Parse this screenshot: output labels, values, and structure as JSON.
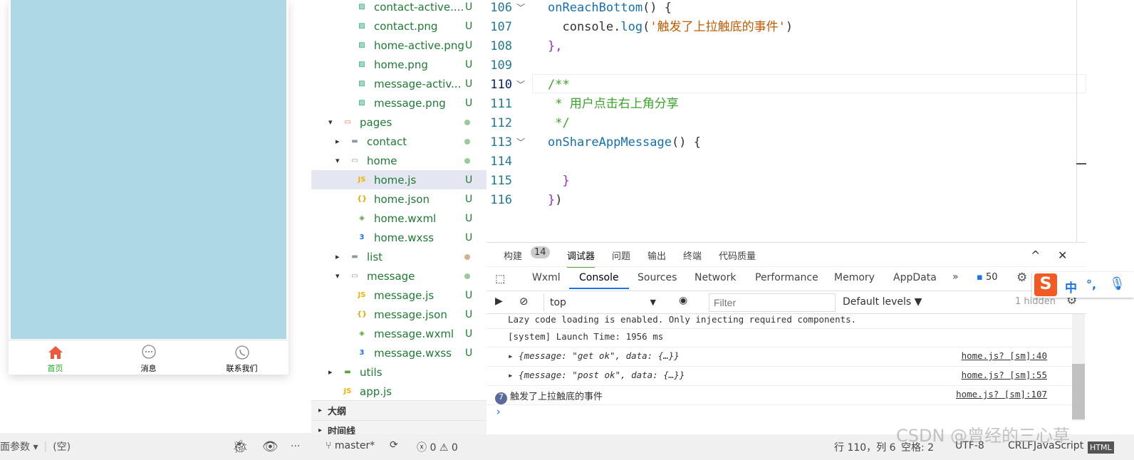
{
  "simulator": {
    "tabs": [
      {
        "label": "首页",
        "icon": "home-icon",
        "active": true
      },
      {
        "label": "消息",
        "icon": "chat-icon"
      },
      {
        "label": "联系我们",
        "icon": "phone-icon"
      }
    ],
    "page_params": "页面参数",
    "empty": "(空)",
    "colors": {
      "screen": "#add8e6",
      "active_tab": "#1aad19",
      "home_icon": "#f05a3c"
    }
  },
  "tree": {
    "items": [
      {
        "label": "contact-active....",
        "status": "U",
        "type": "png",
        "depth": 3
      },
      {
        "label": "contact.png",
        "status": "U",
        "type": "png",
        "depth": 3
      },
      {
        "label": "home-active.png",
        "status": "U",
        "type": "png",
        "depth": 3
      },
      {
        "label": "home.png",
        "status": "U",
        "type": "png",
        "depth": 3
      },
      {
        "label": "message-activ...",
        "status": "U",
        "type": "png",
        "depth": 3
      },
      {
        "label": "message.png",
        "status": "U",
        "type": "png",
        "depth": 3
      },
      {
        "label": "pages",
        "status": "dot",
        "type": "folder-open-red",
        "depth": 1
      },
      {
        "label": "contact",
        "status": "dot",
        "type": "folder",
        "depth": 2
      },
      {
        "label": "home",
        "status": "dot",
        "type": "folder-open",
        "depth": 2
      },
      {
        "label": "home.js",
        "status": "U",
        "type": "js",
        "depth": 3,
        "selected": true
      },
      {
        "label": "home.json",
        "status": "U",
        "type": "json",
        "depth": 3
      },
      {
        "label": "home.wxml",
        "status": "U",
        "type": "wxml",
        "depth": 3
      },
      {
        "label": "home.wxss",
        "status": "U",
        "type": "wxss",
        "depth": 3
      },
      {
        "label": "list",
        "status": "dot-tan",
        "type": "folder",
        "depth": 2
      },
      {
        "label": "message",
        "status": "dot",
        "type": "folder-open",
        "depth": 2
      },
      {
        "label": "message.js",
        "status": "U",
        "type": "js",
        "depth": 3
      },
      {
        "label": "message.json",
        "status": "U",
        "type": "json",
        "depth": 3
      },
      {
        "label": "message.wxml",
        "status": "U",
        "type": "wxml",
        "depth": 3
      },
      {
        "label": "message.wxss",
        "status": "U",
        "type": "wxss",
        "depth": 3
      },
      {
        "label": "utils",
        "status": "",
        "type": "folder-green",
        "depth": 1
      },
      {
        "label": "app.js",
        "status": "",
        "type": "js",
        "depth": 1
      }
    ],
    "sections": [
      "大纲",
      "时间线"
    ]
  },
  "editor": {
    "lines": [
      {
        "n": "106",
        "fold": true,
        "parts": [
          [
            "fn",
            "onReachBottom"
          ],
          [
            "pl",
            "() {"
          ]
        ]
      },
      {
        "n": "107",
        "parts": [
          [
            "pl",
            "  console."
          ],
          [
            "fn",
            "log"
          ],
          [
            "pl",
            "("
          ],
          [
            "str",
            "'触发了上拉触底的事件'"
          ],
          [
            "pl",
            ")"
          ]
        ]
      },
      {
        "n": "108",
        "parts": [
          [
            "kw",
            "},"
          ]
        ]
      },
      {
        "n": "109",
        "parts": []
      },
      {
        "n": "110",
        "fold": true,
        "parts": [
          [
            "cm",
            "/**"
          ]
        ]
      },
      {
        "n": "111",
        "parts": [
          [
            "cm",
            " * 用户点击右上角分享"
          ]
        ]
      },
      {
        "n": "112",
        "parts": [
          [
            "cm",
            " */"
          ]
        ]
      },
      {
        "n": "113",
        "fold": true,
        "parts": [
          [
            "fn",
            "onShareAppMessage"
          ],
          [
            "pl",
            "() {"
          ]
        ]
      },
      {
        "n": "114",
        "parts": []
      },
      {
        "n": "115",
        "parts": [
          [
            "kw",
            "  }"
          ]
        ]
      },
      {
        "n": "116",
        "parts": [
          [
            "kw",
            "}"
          ],
          [
            "pl",
            ")"
          ]
        ]
      }
    ]
  },
  "panel": {
    "tabs": [
      "构建",
      "调试器",
      "问题",
      "输出",
      "终端",
      "代码质量"
    ],
    "build_badge": "14",
    "active_tab": "调试器",
    "devtabs": [
      "Wxml",
      "Console",
      "Sources",
      "Network",
      "Performance",
      "Memory",
      "AppData"
    ],
    "active_devtab": "Console",
    "more": "»",
    "message_count": "50",
    "context": "top",
    "filter_placeholder": "Filter",
    "levels": "Default levels ▼",
    "hidden": "1 hidden",
    "console": [
      {
        "text": "Lazy code loading is enabled. Only injecting required components."
      },
      {
        "text": "[system] Launch Time: 1956 ms"
      },
      {
        "text": "▸ {message: \"get ok\", data: {…}}",
        "src": "home.js? [sm]:40"
      },
      {
        "text": "▸ {message: \"post ok\", data: {…}}",
        "src": "home.js? [sm]:55"
      },
      {
        "text": "触发了上拉触底的事件",
        "src": "home.js? [sm]:107",
        "count": "7"
      }
    ],
    "prompt": "›"
  },
  "statusbar": {
    "branch": "master*",
    "errors": "0",
    "warnings": "0",
    "position": "行 110，列 6",
    "spaces": "空格: 2",
    "encoding": "UTF-8",
    "eol": "CRLF",
    "language": "JavaScript",
    "extra": "HTML"
  },
  "ime": {
    "label": "中",
    "punct": "°,"
  },
  "watermark": "CSDN @曾经的三心草"
}
